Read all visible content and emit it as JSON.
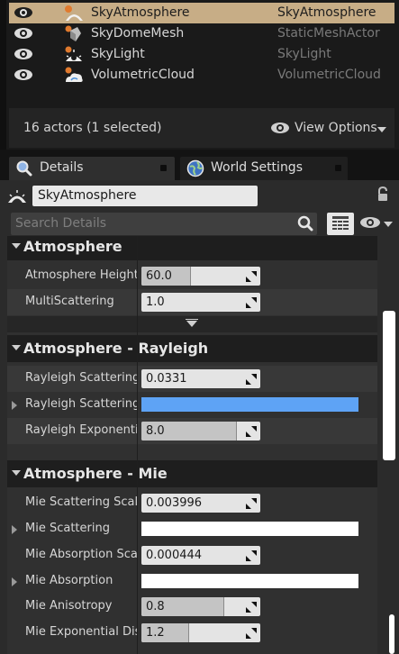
{
  "outliner": {
    "rows": [
      {
        "name": "SkyAtmosphere",
        "type": "SkyAtmosphere",
        "selected": true,
        "icon": "sky-atmosphere-icon"
      },
      {
        "name": "SkyDomeMesh",
        "type": "StaticMeshActor",
        "selected": false,
        "icon": "static-mesh-icon"
      },
      {
        "name": "SkyLight",
        "type": "SkyLight",
        "selected": false,
        "icon": "sky-light-icon"
      },
      {
        "name": "VolumetricCloud",
        "type": "VolumetricCloud",
        "selected": false,
        "icon": "volumetric-cloud-icon"
      }
    ],
    "status": "16 actors (1 selected)",
    "view_options": "View Options"
  },
  "tabs": [
    {
      "label": "Details",
      "icon": "search-icon",
      "active": true
    },
    {
      "label": "World Settings",
      "icon": "globe-icon",
      "active": false
    }
  ],
  "details": {
    "actor_name": "SkyAtmosphere",
    "search_placeholder": "Search Details"
  },
  "categories": {
    "atmosphere": {
      "title": "Atmosphere",
      "props": [
        {
          "label": "Atmosphere Height",
          "value": "60.0",
          "fill": 0.47
        },
        {
          "label": "MultiScattering",
          "value": "1.0",
          "fill": 0
        }
      ]
    },
    "rayleigh": {
      "title": "Atmosphere - Rayleigh",
      "props": [
        {
          "label": "Rayleigh Scattering Sc",
          "value": "0.0331",
          "fill": 0
        },
        {
          "label": "Rayleigh Scattering",
          "color": "#5ea3f5"
        },
        {
          "label": "Rayleigh Exponential D",
          "value": "8.0",
          "fill": 0.9
        }
      ]
    },
    "mie": {
      "title": "Atmosphere - Mie",
      "props": [
        {
          "label": "Mie Scattering Scale",
          "value": "0.003996",
          "fill": 0
        },
        {
          "label": "Mie Scattering",
          "color": "#ffffff"
        },
        {
          "label": "Mie Absorption Scale",
          "value": "0.000444",
          "fill": 0
        },
        {
          "label": "Mie Absorption",
          "color": "#ffffff"
        },
        {
          "label": "Mie Anisotropy",
          "value": "0.8",
          "fill": 0.78
        },
        {
          "label": "Mie Exponential Distri",
          "value": "1.2",
          "fill": 0.45
        }
      ]
    }
  },
  "colors": {
    "selection": "#c7ad86",
    "rayleigh_color": "#5ea3f5",
    "mie_color": "#ffffff"
  }
}
